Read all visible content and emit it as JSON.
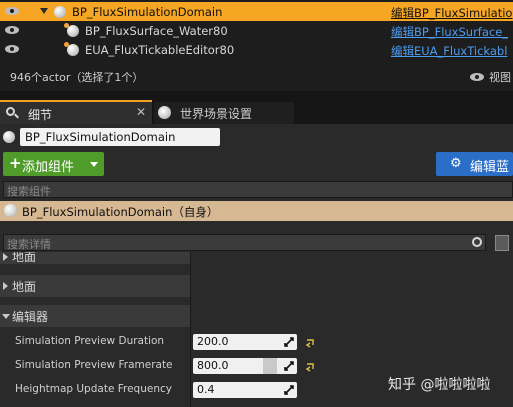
{
  "outliner": {
    "rows": [
      {
        "name": "BP_FluxSimulationDomain",
        "link": "编辑BP_FluxSimulatio",
        "selected": true
      },
      {
        "name": "BP_FluxSurface_Water80",
        "link": "编辑BP_FluxSurface_",
        "selected": false
      },
      {
        "name": "EUA_FluxTickableEditor80",
        "link": "编辑EUA_FluxTickabl",
        "selected": false
      }
    ],
    "status": "946个actor（选择了1个）",
    "view_label": "视图"
  },
  "tabs": [
    {
      "label": "细节",
      "icon": "search-icon",
      "active": true
    },
    {
      "label": "世界场景设置",
      "icon": "globe-icon",
      "active": false
    }
  ],
  "details": {
    "actor_name": "BP_FluxSimulationDomain",
    "add_component_label": "添加组件",
    "edit_blueprint_label": "编辑蓝",
    "search_components_placeholder": "搜索组件",
    "root_component": "BP_FluxSimulationDomain（自身）",
    "search_details_placeholder": "搜索详情",
    "sections": [
      {
        "label": "地面",
        "expanded": false
      },
      {
        "label": "地面",
        "expanded": false
      },
      {
        "label": "编辑器",
        "expanded": true
      }
    ],
    "properties": [
      {
        "label": "Simulation Preview Duration",
        "value": "200.0"
      },
      {
        "label": "Simulation Preview Framerate",
        "value": "800.0"
      },
      {
        "label": "Heightmap Update Frequency",
        "value": "0.4"
      }
    ]
  },
  "watermark": "知乎 @啦啦啦啦",
  "colors": {
    "selected_row": "#f6a623",
    "link": "#4d9cf0",
    "add_button": "#4f9c2b",
    "edit_button": "#2a6ec8",
    "root_component_bg": "#d6b893"
  }
}
